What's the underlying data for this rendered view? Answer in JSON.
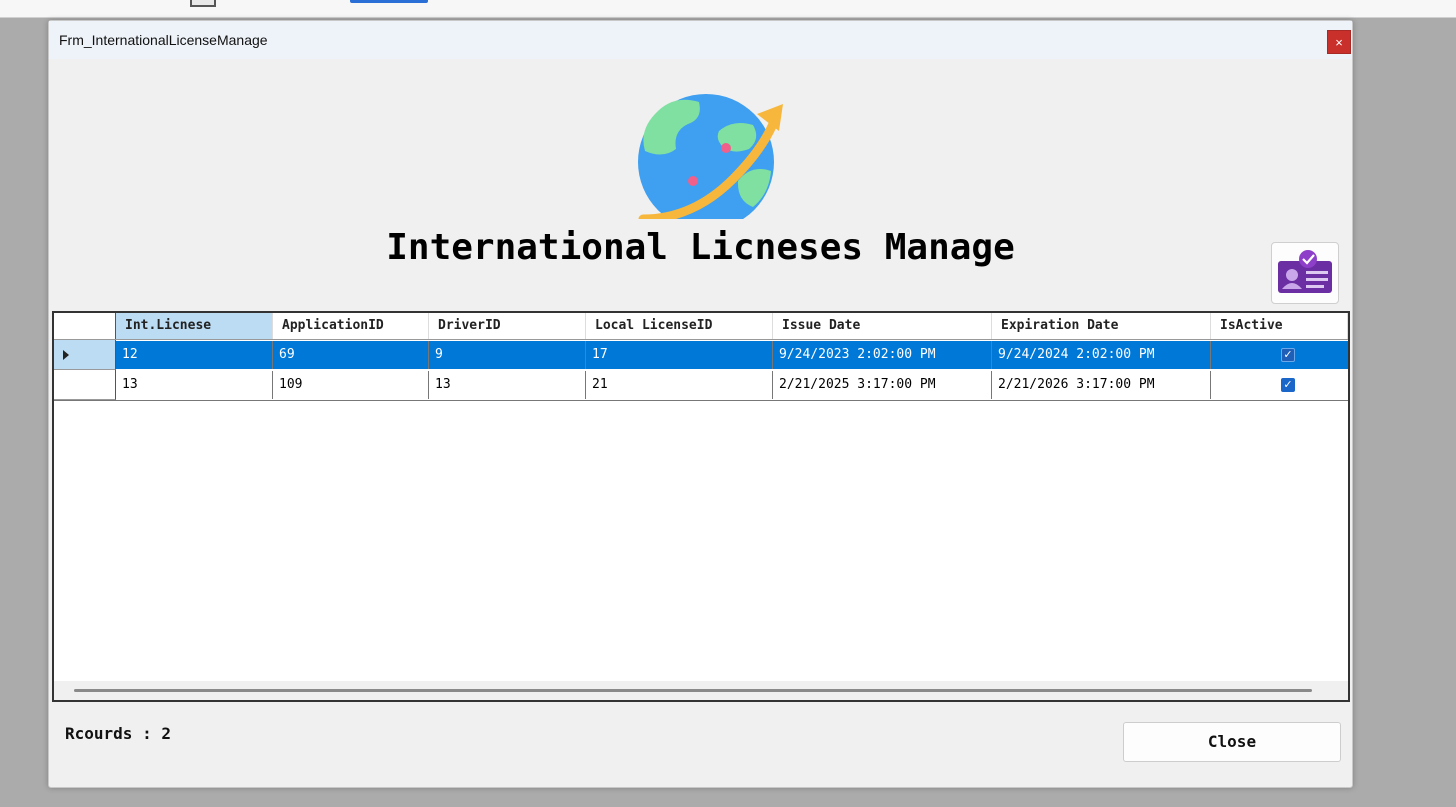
{
  "window": {
    "title": "Frm_InternationalLicenseManage",
    "close_glyph": "×"
  },
  "heading": "International Licneses Manage",
  "grid": {
    "columns": [
      "Int.Licnese",
      "ApplicationID",
      "DriverID",
      "Local LicenseID",
      "Issue Date",
      "Expiration Date",
      "IsActive"
    ],
    "rows": [
      {
        "int_license": "12",
        "application_id": "69",
        "driver_id": "9",
        "local_license_id": "17",
        "issue_date": "9/24/2023 2:02:00 PM",
        "expiration_date": "9/24/2024 2:02:00 PM",
        "is_active": true
      },
      {
        "int_license": "13",
        "application_id": "109",
        "driver_id": "13",
        "local_license_id": "21",
        "issue_date": "2/21/2025 3:17:00 PM",
        "expiration_date": "2/21/2026 3:17:00 PM",
        "is_active": true
      }
    ],
    "selected_row": 0
  },
  "records_label": "Rcourds : 2",
  "close_button": "Close",
  "icons": [
    "globe-icon",
    "license-card-icon",
    "row-pointer-icon",
    "checkbox-checked-icon"
  ],
  "colors": {
    "selection": "#0078d7",
    "header_selected": "#bcdcf4",
    "title_close": "#c9302c"
  }
}
